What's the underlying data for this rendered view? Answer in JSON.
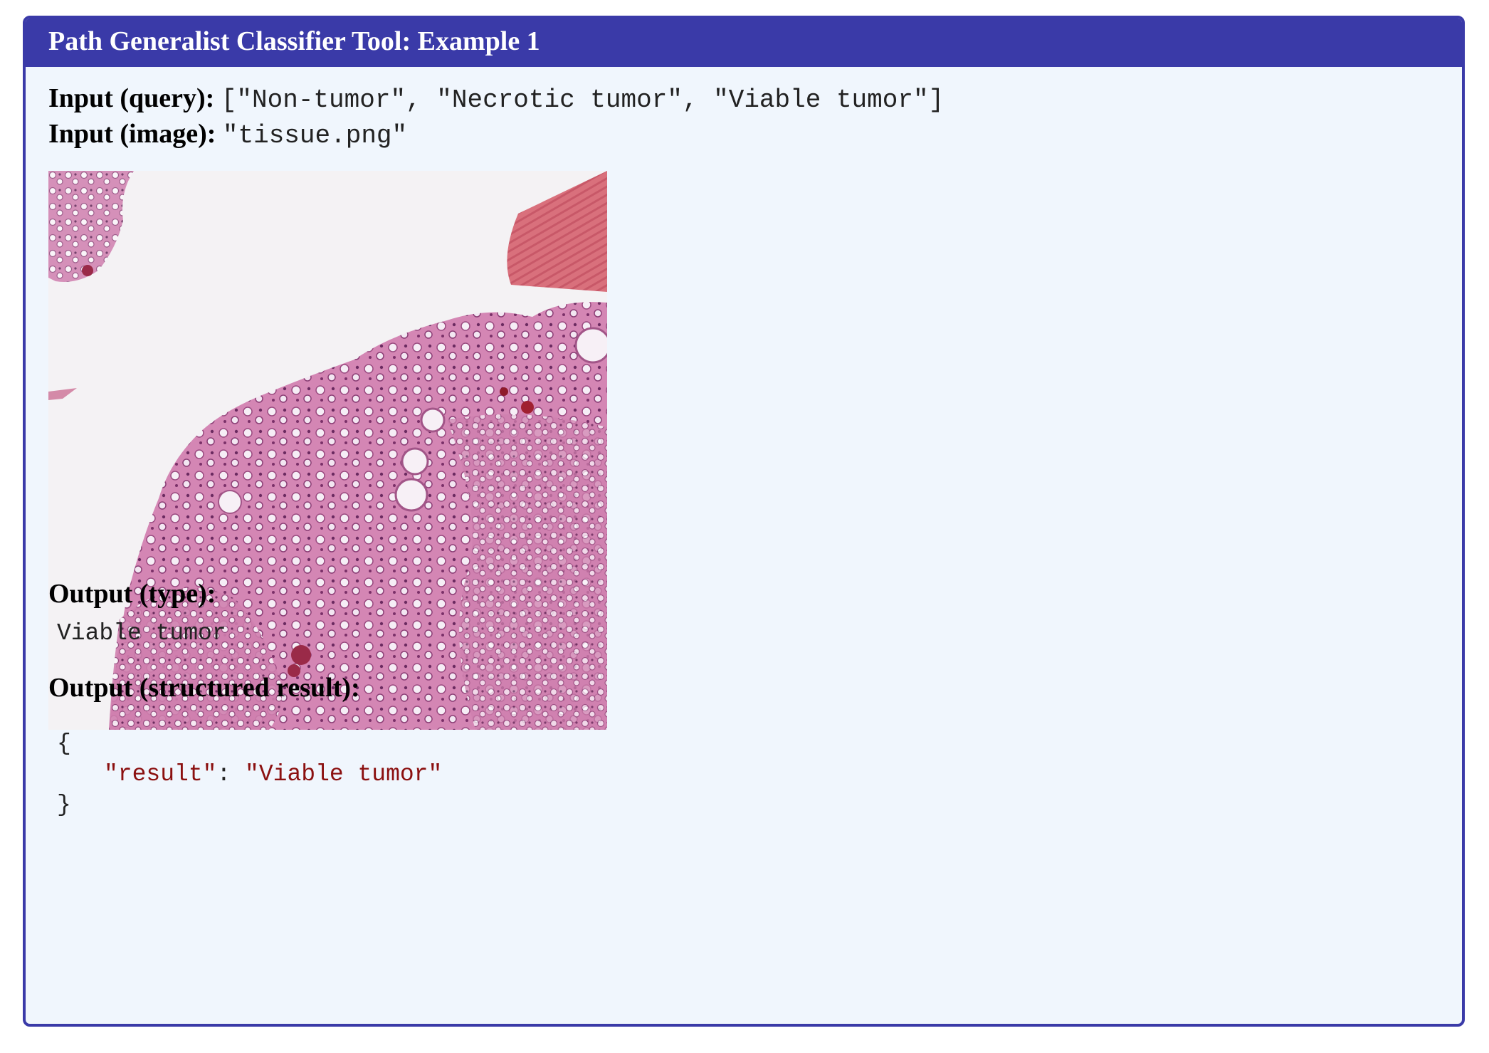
{
  "title": "Path Generalist Classifier Tool: Example 1",
  "input_query": {
    "label": "Input (query):",
    "value": "[\"Non-tumor\", \"Necrotic tumor\", \"Viable tumor\"]"
  },
  "input_image": {
    "label": "Input (image):",
    "value": "\"tissue.png\""
  },
  "output_type": {
    "label": "Output (type):",
    "value": "Viable tumor"
  },
  "output_structured": {
    "label": "Output (structured result):",
    "open_brace": "{",
    "key": "\"result\"",
    "colon": ": ",
    "value": "\"Viable tumor\"",
    "close_brace": "}"
  },
  "colors": {
    "header": "#3a3aa8",
    "panel_bg": "#f0f6fd",
    "string": "#8b1010"
  }
}
